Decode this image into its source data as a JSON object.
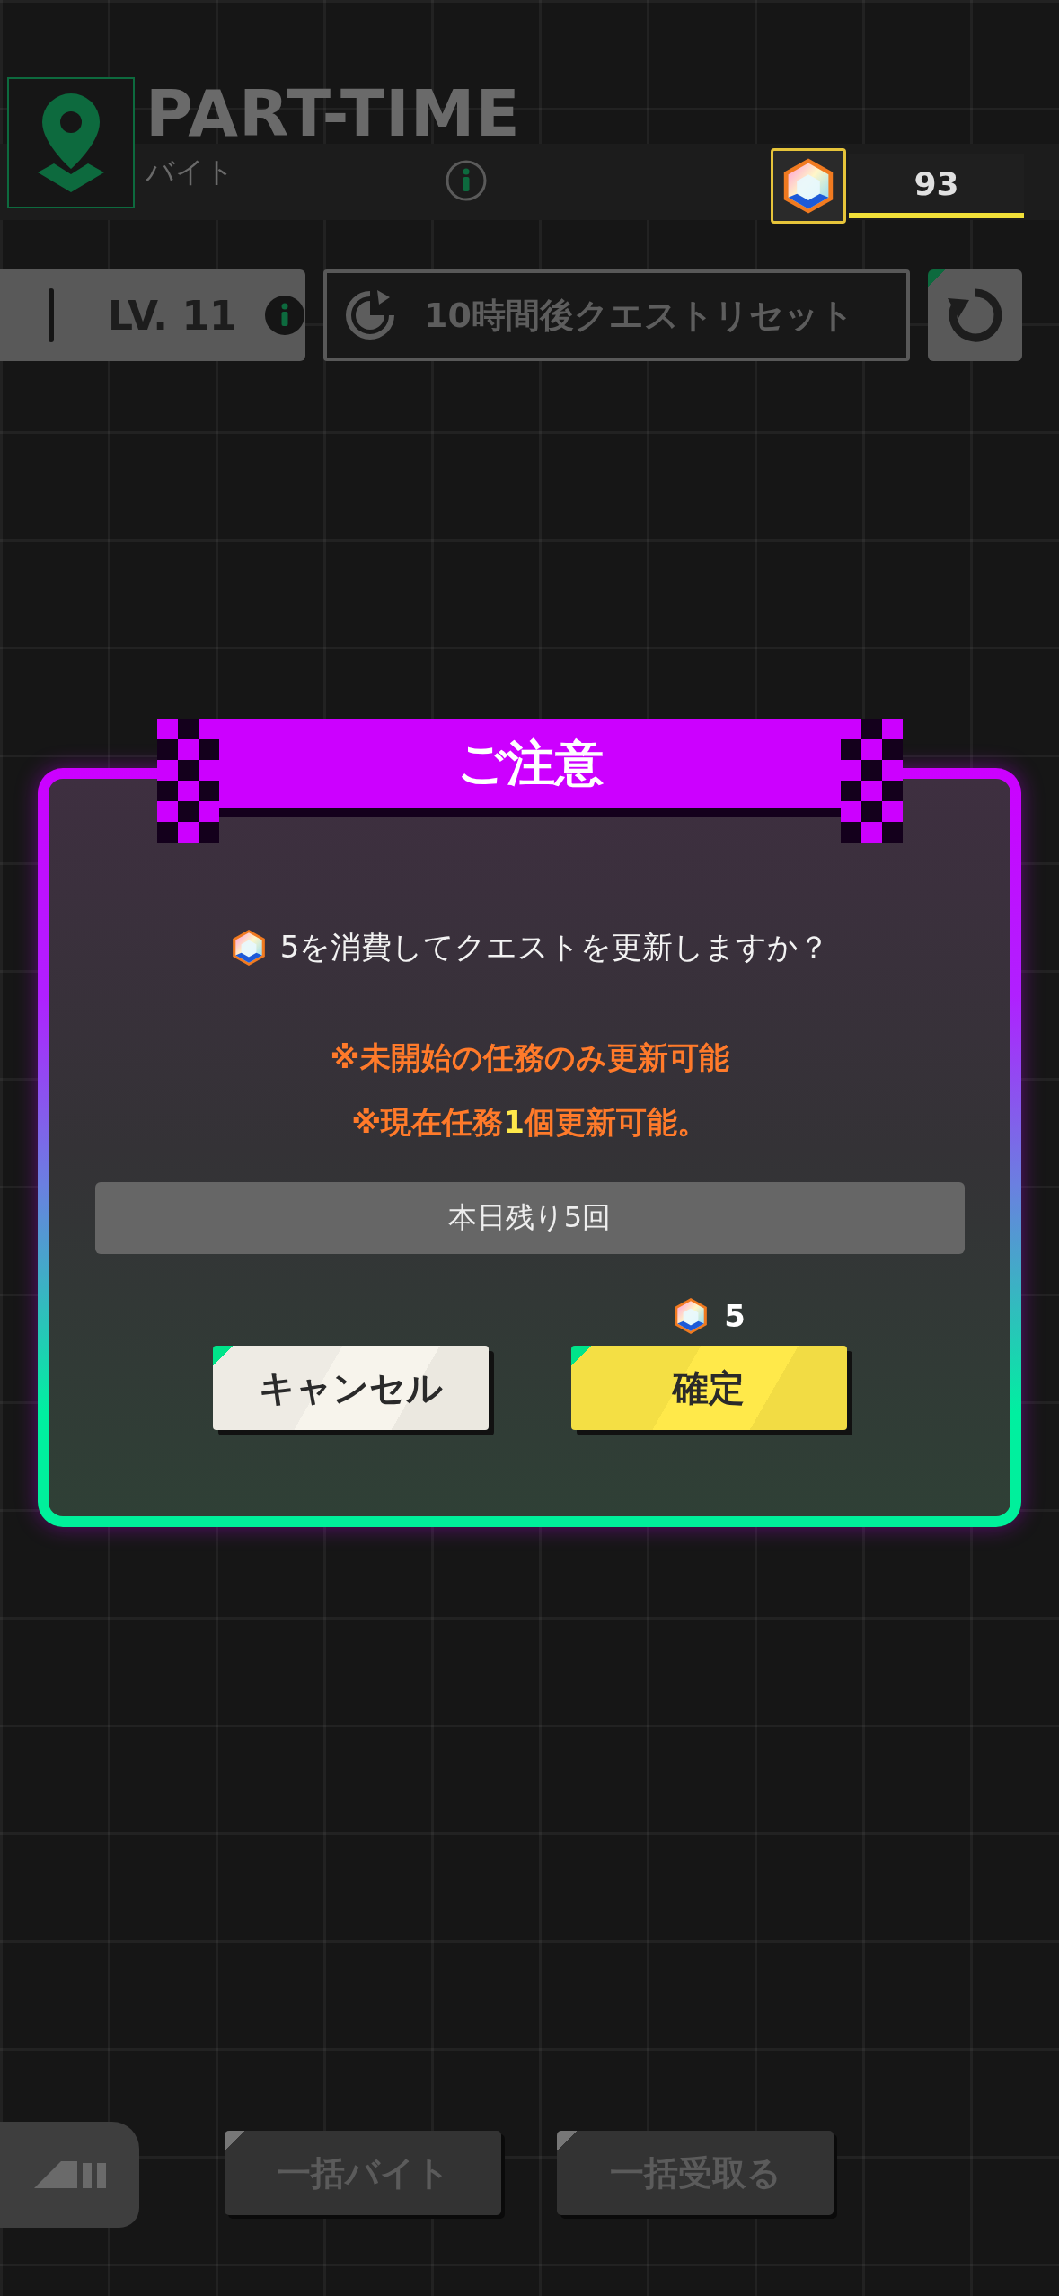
{
  "header": {
    "title": "PART-TIME",
    "subtitle": "バイト",
    "gem_count": "93"
  },
  "status_row": {
    "level": "LV. 11",
    "reset_text": "10時間後クエストリセット"
  },
  "dialog": {
    "title": "ご注意",
    "message": "5を消費してクエストを更新しますか？",
    "notes": [
      "※未開始の任務のみ更新可能",
      "※現在任務**1**個更新可能。"
    ],
    "remaining": "本日残り5回",
    "cost": "5",
    "buttons": [
      {
        "label": "キャンセル",
        "kind": "secondary"
      },
      {
        "label": "確定",
        "kind": "primary"
      }
    ]
  },
  "bottom_bar": {
    "buttons": [
      {
        "label": "一括バイト",
        "disabled": true
      },
      {
        "label": "一括受取る",
        "disabled": true
      }
    ]
  }
}
